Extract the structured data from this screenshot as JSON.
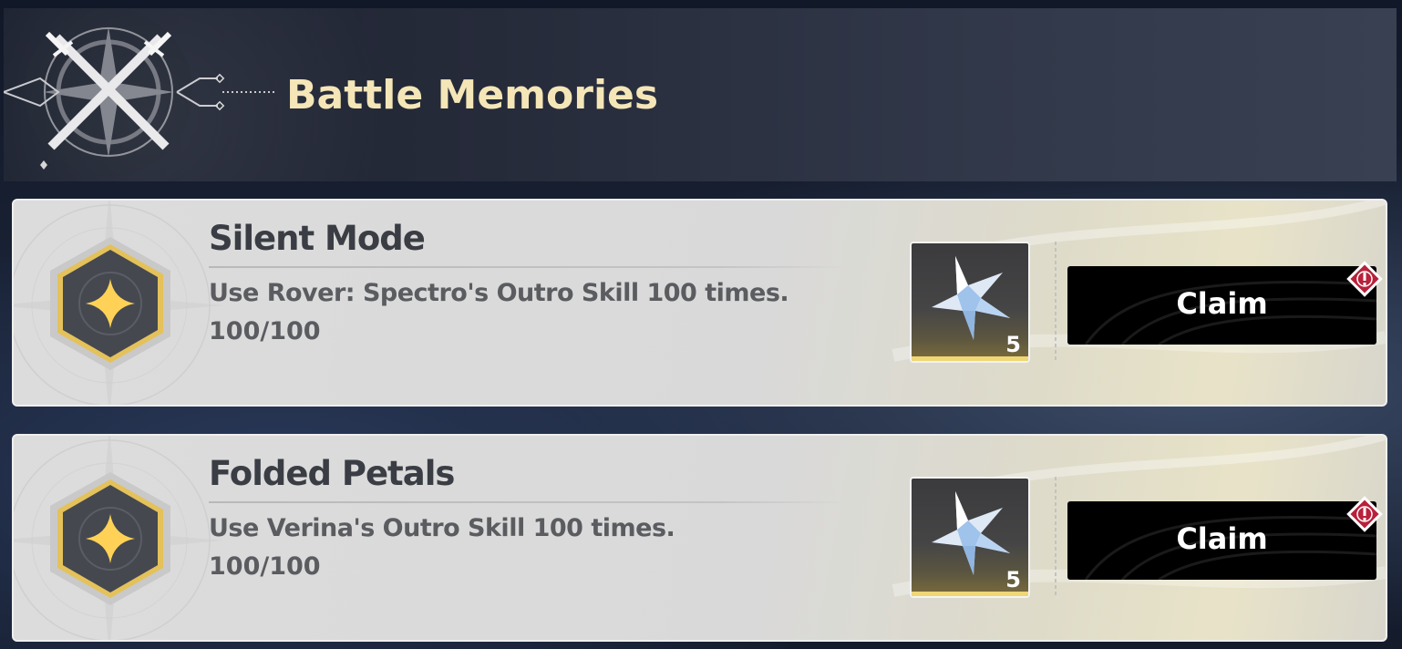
{
  "header": {
    "title": "Battle Memories",
    "emblem_icon": "crossed-swords-icon"
  },
  "quests": [
    {
      "title": "Silent Mode",
      "description": "Use Rover: Spectro's Outro Skill 100 times.",
      "progress": "100/100",
      "badge_icon": "sparkle-star-icon",
      "reward": {
        "icon": "crystal-star-icon",
        "quantity": "5"
      },
      "claim_label": "Claim",
      "alert_icon": "exclamation-icon"
    },
    {
      "title": "Folded Petals",
      "description": "Use Verina's Outro Skill 100 times.",
      "progress": "100/100",
      "badge_icon": "sparkle-star-icon",
      "reward": {
        "icon": "crystal-star-icon",
        "quantity": "5"
      },
      "claim_label": "Claim",
      "alert_icon": "exclamation-icon"
    }
  ],
  "colors": {
    "title_gold": "#f5e6b8",
    "badge_gold": "#e4c15a",
    "alert_red": "#b8203b",
    "rarity_gold": "#f0d776"
  }
}
